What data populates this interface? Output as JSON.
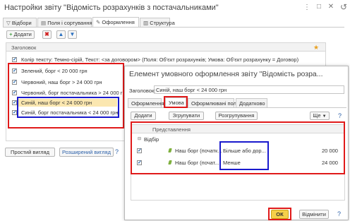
{
  "back_window": {
    "title": "Настройки звіту \"Відомість розрахунків з постачальниками\"",
    "tabs": [
      "Відбори",
      "Поля і сортування",
      "Оформлення",
      "Структура"
    ],
    "add_label": "Додати",
    "column_header": "Заголовок",
    "first_row": "Колір тексту: Темно-сірій, Текст: <за договором> (Поля: Об'єкт розрахунків; Умова: Об'єкт розрахунку = Договор)",
    "items": [
      "Зелений, борг < 20 000 грн",
      "Червоний, наш борг > 24 000 грн",
      "Червоний, борг постачальника > 24 000 грн",
      "Синій, наш борг < 24 000 грн",
      "Синій, борг постачальника < 24 000 грн"
    ],
    "simple_view": "Простий вигляд",
    "advanced_view": "Розширений вигляд",
    "help": "?"
  },
  "front_window": {
    "title": "Елемент умовного оформлення звіту \"Відомість розра...",
    "heading_label": "Заголовок:",
    "heading_value": "Синій, наш борг < 24 000 грн",
    "tabs": [
      "Оформлення",
      "Умова",
      "Оформлювані поля",
      "Додатково"
    ],
    "buttons": {
      "add": "Додати",
      "group": "Згрупувати",
      "ungroup": "Розгрупування",
      "more": "Ще",
      "more_help": "?"
    },
    "column_header": "Представлення",
    "group_label": "Відбір",
    "rows": [
      {
        "field": "Наш борг (початк...",
        "condition": "Більше або дор...",
        "value": "20 000"
      },
      {
        "field": "Наш борг (почат...",
        "condition": "Менше",
        "value": "24 000"
      }
    ],
    "ok": "ОК",
    "cancel": "Відмінити",
    "help": "?"
  },
  "colors": {
    "highlight_red": "#e01a1a",
    "highlight_blue": "#1a1acd",
    "selection": "#fbe7b0"
  }
}
